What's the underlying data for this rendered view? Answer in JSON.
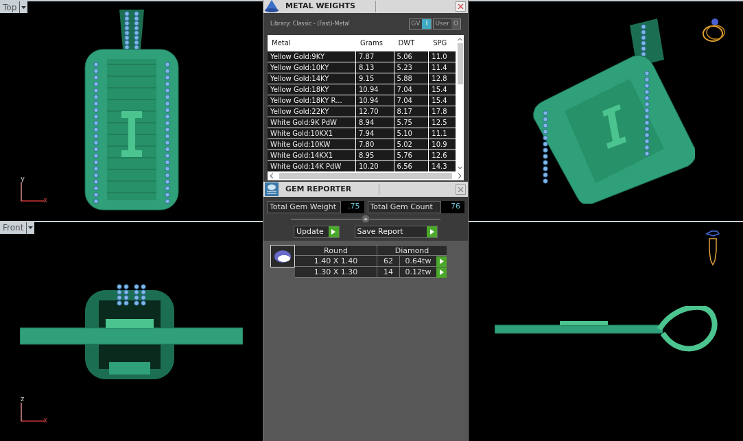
{
  "viewports": [
    {
      "label": "Top",
      "axes": [
        "y",
        "x"
      ]
    },
    {
      "label": "Front",
      "axes": [
        "z",
        "x"
      ]
    }
  ],
  "metal_weights": {
    "title": "METAL WEIGHTS",
    "library": "Library: Classic - (Fast)-Metal",
    "toggles": [
      {
        "label": "GV",
        "glyph": "I",
        "on": true
      },
      {
        "label": "User",
        "glyph": "O",
        "on": false
      }
    ],
    "table": {
      "columns": [
        "Metal",
        "Grams",
        "DWT",
        "SPG"
      ],
      "rows": [
        [
          "Yellow Gold:9KY",
          "7.87",
          "5.06",
          "11.0"
        ],
        [
          "Yellow Gold:10KY",
          "8.13",
          "5.23",
          "11.4"
        ],
        [
          "Yellow Gold:14KY",
          "9.15",
          "5.88",
          "12.8"
        ],
        [
          "Yellow Gold:18KY",
          "10.94",
          "7.04",
          "15.4"
        ],
        [
          "Yellow Gold:18KY R...",
          "10.94",
          "7.04",
          "15.4"
        ],
        [
          "Yellow Gold:22KY",
          "12.70",
          "8.17",
          "17.8"
        ],
        [
          "White Gold:9K PdW",
          "8.94",
          "5.75",
          "12.5"
        ],
        [
          "White Gold:10KX1",
          "7.94",
          "5.10",
          "11.1"
        ],
        [
          "White Gold:10KW",
          "7.80",
          "5.02",
          "10.9"
        ],
        [
          "White Gold:14KX1",
          "8.95",
          "5.76",
          "12.6"
        ],
        [
          "White Gold:14K PdW",
          "10.20",
          "6.56",
          "14.3"
        ]
      ]
    }
  },
  "gem_reporter": {
    "title": "GEM REPORTER",
    "totals": [
      {
        "label": "Total Gem Weight",
        "value": ".75"
      },
      {
        "label": "Total Gem Count",
        "value": "76"
      }
    ],
    "buttons": [
      "Update",
      "Save Report"
    ],
    "table": {
      "columns": [
        "Round",
        "Diamond"
      ],
      "rows": [
        {
          "size": "1.40 X 1.40",
          "count": "62",
          "weight": "0.64tw"
        },
        {
          "size": "1.30 X 1.30",
          "count": "14",
          "weight": "0.12tw"
        }
      ]
    }
  }
}
